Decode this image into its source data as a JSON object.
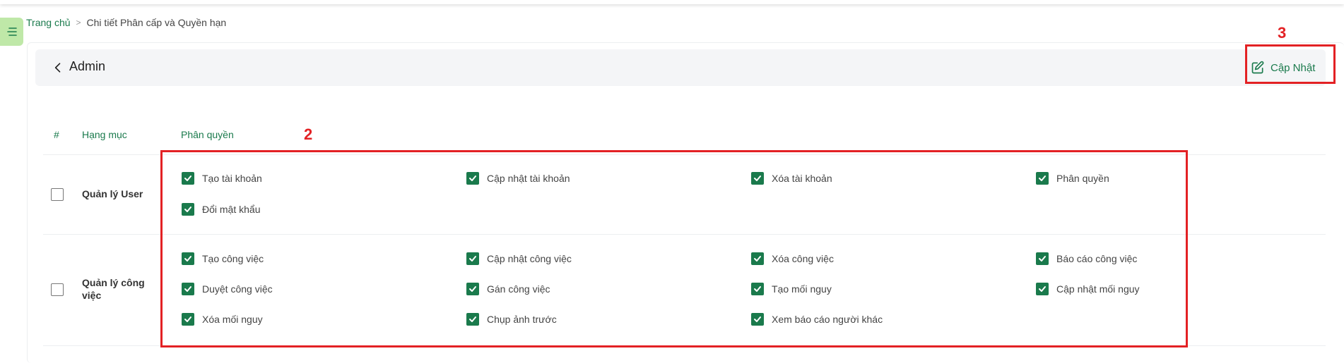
{
  "breadcrumb": {
    "home": "Trang chủ",
    "separator": ">",
    "current": "Chi tiết Phân cấp và Quyền hạn"
  },
  "header": {
    "title": "Admin",
    "update_label": "Cập Nhật"
  },
  "table": {
    "col_index": "#",
    "col_category": "Hạng mục",
    "col_permission": "Phân quyền"
  },
  "groups": [
    {
      "name": "Quản lý User",
      "checked": false,
      "permissions": [
        {
          "label": "Tạo tài khoản",
          "checked": true
        },
        {
          "label": "Cập nhật tài khoản",
          "checked": true
        },
        {
          "label": "Xóa tài khoản",
          "checked": true
        },
        {
          "label": "Phân quyền",
          "checked": true
        },
        {
          "label": "Đổi mật khẩu",
          "checked": true
        }
      ]
    },
    {
      "name": "Quản lý công việc",
      "checked": false,
      "permissions": [
        {
          "label": "Tạo công việc",
          "checked": true
        },
        {
          "label": "Cập nhật công việc",
          "checked": true
        },
        {
          "label": "Xóa công việc",
          "checked": true
        },
        {
          "label": "Báo cáo công việc",
          "checked": true
        },
        {
          "label": "Duyệt công việc",
          "checked": true
        },
        {
          "label": "Gán công việc",
          "checked": true
        },
        {
          "label": "Tạo mối nguy",
          "checked": true
        },
        {
          "label": "Cập nhật mối nguy",
          "checked": true
        },
        {
          "label": "Xóa mối nguy",
          "checked": true
        },
        {
          "label": "Chụp ảnh trước",
          "checked": true
        },
        {
          "label": "Xem báo cáo người khác",
          "checked": true
        }
      ]
    }
  ],
  "annotations": {
    "permissions_box": "2",
    "update_box": "3"
  },
  "colors": {
    "accent": "#1a7a4c",
    "callout": "#e32124",
    "menu_bg": "#bfe8a8"
  }
}
